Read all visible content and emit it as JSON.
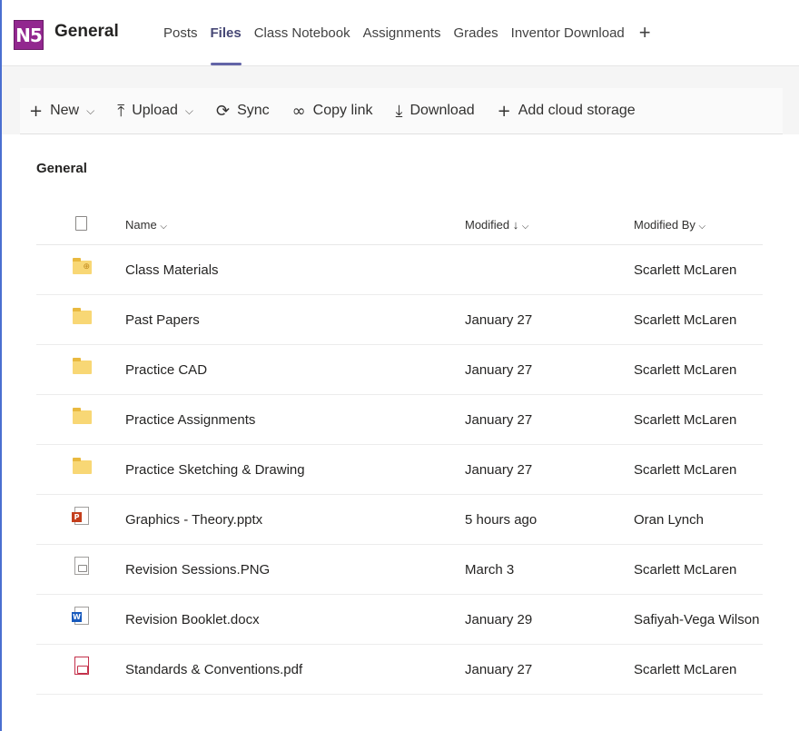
{
  "header": {
    "team_badge": "N5",
    "channel": "General",
    "tabs": [
      {
        "label": "Posts"
      },
      {
        "label": "Files"
      },
      {
        "label": "Class Notebook"
      },
      {
        "label": "Assignments"
      },
      {
        "label": "Grades"
      },
      {
        "label": "Inventor Download"
      }
    ],
    "active_tab": "Files",
    "add_tab_glyph": "+"
  },
  "toolbar": {
    "new": "New",
    "upload": "Upload",
    "sync": "Sync",
    "copy_link": "Copy link",
    "download": "Download",
    "add_cloud": "Add cloud storage"
  },
  "breadcrumb": "General",
  "columns": {
    "name": "Name",
    "modified": "Modified",
    "modified_by": "Modified By"
  },
  "files": [
    {
      "name": "Class Materials",
      "modified": "",
      "modified_by": "Scarlett McLaren",
      "type": "shared-folder"
    },
    {
      "name": "Past Papers",
      "modified": "January 27",
      "modified_by": "Scarlett McLaren",
      "type": "folder"
    },
    {
      "name": "Practice CAD",
      "modified": "January 27",
      "modified_by": "Scarlett McLaren",
      "type": "folder"
    },
    {
      "name": "Practice Assignments",
      "modified": "January 27",
      "modified_by": "Scarlett McLaren",
      "type": "folder"
    },
    {
      "name": "Practice Sketching & Drawing",
      "modified": "January 27",
      "modified_by": "Scarlett McLaren",
      "type": "folder"
    },
    {
      "name": "Graphics - Theory.pptx",
      "modified": "5 hours ago",
      "modified_by": "Oran Lynch",
      "type": "pptx"
    },
    {
      "name": "Revision Sessions.PNG",
      "modified": "March 3",
      "modified_by": "Scarlett McLaren",
      "type": "png"
    },
    {
      "name": "Revision Booklet.docx",
      "modified": "January 29",
      "modified_by": "Safiyah-Vega Wilson",
      "type": "docx"
    },
    {
      "name": "Standards & Conventions.pdf",
      "modified": "January 27",
      "modified_by": "Scarlett McLaren",
      "type": "pdf"
    }
  ],
  "colors": {
    "team_badge": "#92278f",
    "active_tab": "#6264a7",
    "folder": "#f8d775"
  }
}
